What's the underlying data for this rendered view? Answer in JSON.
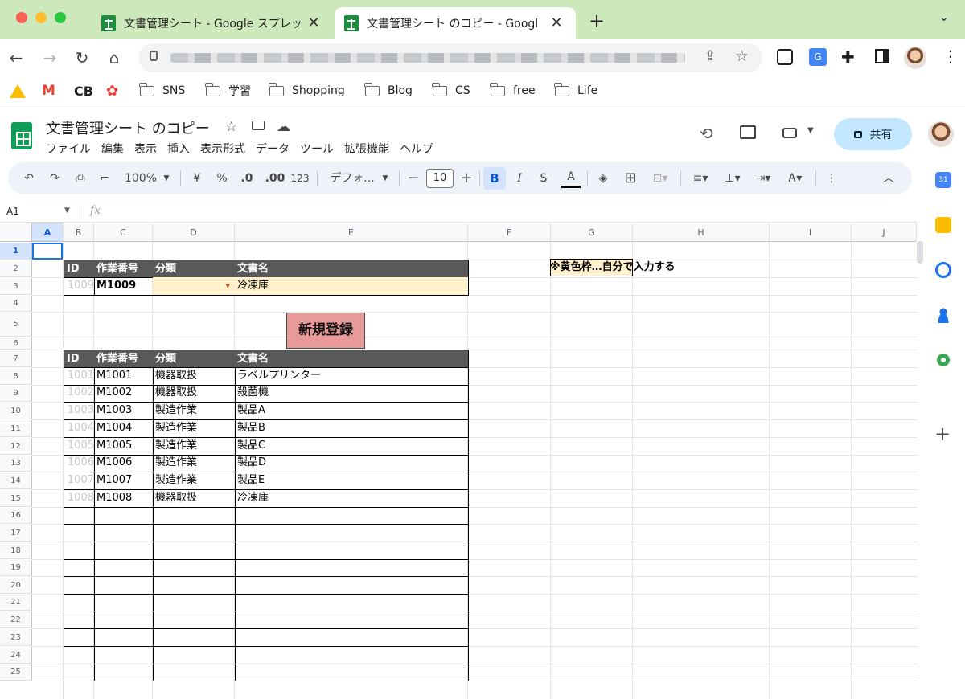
{
  "browser": {
    "tabs": [
      {
        "title": "文書管理シート - Google スプレッ",
        "active": false
      },
      {
        "title": "文書管理シート のコピー - Googl",
        "active": true
      }
    ],
    "new_tab_label": "+",
    "tab_close_glyph": "✕",
    "bookmarks": [
      {
        "label": "SNS",
        "icon": "folder-icon"
      },
      {
        "label": "学習",
        "icon": "folder-icon"
      },
      {
        "label": "Shopping",
        "icon": "folder-icon"
      },
      {
        "label": "Blog",
        "icon": "folder-icon"
      },
      {
        "label": "CS",
        "icon": "folder-icon"
      },
      {
        "label": "free",
        "icon": "folder-icon"
      },
      {
        "label": "Life",
        "icon": "folder-icon"
      }
    ]
  },
  "sheets": {
    "doc_title": "文書管理シート のコピー",
    "menu": [
      "ファイル",
      "編集",
      "表示",
      "挿入",
      "表示形式",
      "データ",
      "ツール",
      "拡張機能",
      "ヘルプ"
    ],
    "share_label": "共有",
    "toolbar": {
      "zoom": "100%",
      "currency": "¥",
      "percent": "%",
      "dec_decrease": ".0",
      "dec_increase": ".00",
      "number_format": "123",
      "font": "デフォ...",
      "font_size": "10",
      "bold": "B",
      "italic": "I",
      "text_color": "A"
    },
    "name_box": "A1",
    "fx_label": "fx",
    "columns": [
      "A",
      "B",
      "C",
      "D",
      "E",
      "F",
      "G",
      "H",
      "I",
      "J"
    ],
    "rows": [
      "1",
      "2",
      "3",
      "4",
      "5",
      "6",
      "7",
      "8",
      "9",
      "10",
      "11",
      "12",
      "13",
      "14",
      "15",
      "16",
      "17",
      "18",
      "19",
      "20",
      "21",
      "22",
      "23",
      "24",
      "25"
    ],
    "input_table": {
      "headers": [
        "ID",
        "作業番号",
        "分類",
        "文書名"
      ],
      "row": [
        "1009",
        "M1009",
        "",
        "冷凍庫"
      ]
    },
    "register_button": "新規登録",
    "note": "※黄色枠…自分で入力する",
    "data_table": {
      "headers": [
        "ID",
        "作業番号",
        "分類",
        "文書名"
      ],
      "rows": [
        [
          "1001",
          "M1001",
          "機器取扱",
          "ラベルプリンター"
        ],
        [
          "1002",
          "M1002",
          "機器取扱",
          "殺菌機"
        ],
        [
          "1003",
          "M1003",
          "製造作業",
          "製品A"
        ],
        [
          "1004",
          "M1004",
          "製造作業",
          "製品B"
        ],
        [
          "1005",
          "M1005",
          "製造作業",
          "製品C"
        ],
        [
          "1006",
          "M1006",
          "製造作業",
          "製品D"
        ],
        [
          "1007",
          "M1007",
          "製造作業",
          "製品E"
        ],
        [
          "1008",
          "M1008",
          "機器取扱",
          "冷凍庫"
        ]
      ]
    }
  },
  "colors": {
    "header_fill": "#595959",
    "input_fill": "#fff2cc",
    "button_fill": "#e8999a",
    "selection": "#1a73e8"
  }
}
